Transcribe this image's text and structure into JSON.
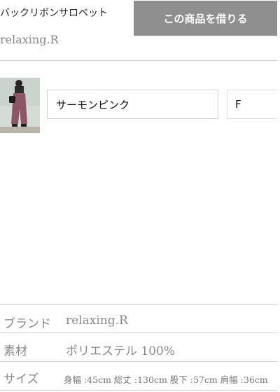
{
  "product": {
    "title": "バックリボンサロペット",
    "brand": "relaxing.R",
    "rent_button_label": "この商品を借りる"
  },
  "selection": {
    "thumbnail_icon": "product-photo",
    "color": "サーモンピンク",
    "size": "F"
  },
  "specs": {
    "rows": [
      {
        "label": "ブランド",
        "value": "relaxing.R"
      },
      {
        "label": "素材",
        "value": "ポリエステル 100%"
      },
      {
        "label": "サイズ",
        "value": "身幅 :45cm 総丈 :130cm 股下 :57cm 肩幅 :36cm"
      }
    ]
  },
  "colors": {
    "button_bg": "#8f8f8f",
    "muted_text": "#8a8a8a",
    "divider": "#cfcfcf"
  }
}
